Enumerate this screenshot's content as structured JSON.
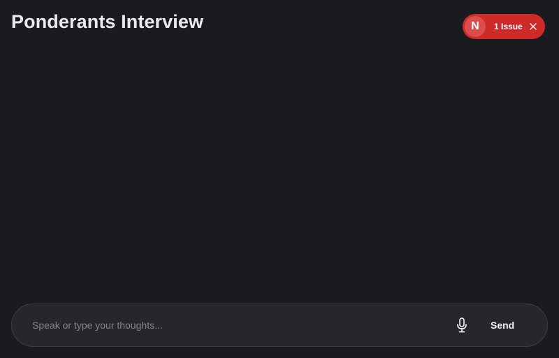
{
  "header": {
    "title": "Ponderants Interview"
  },
  "issues": {
    "avatar_letter": "N",
    "label": "1 Issue",
    "color": "#cf2a2a"
  },
  "composer": {
    "placeholder": "Speak or type your thoughts...",
    "value": "",
    "send_label": "Send",
    "mic_icon": "microphone-icon"
  },
  "colors": {
    "background": "#1a1b1e",
    "composer_background": "#25272b",
    "text": "#e9ebee"
  }
}
